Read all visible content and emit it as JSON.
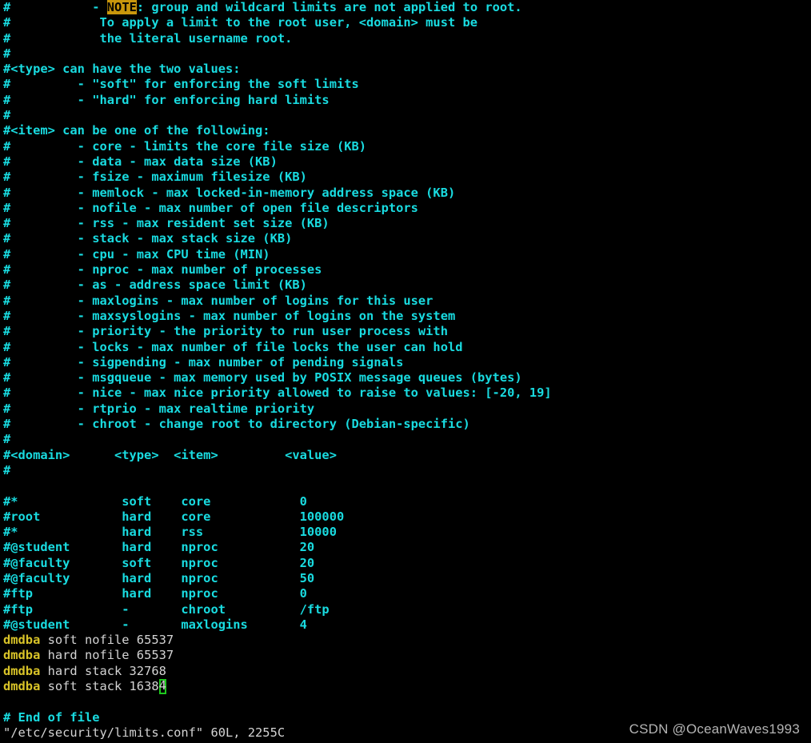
{
  "app": {
    "type": "terminal-text-editor",
    "editor": "vim",
    "background_color": "#000000",
    "comment_color": "#19dbe0",
    "value_color": "#d4d4d4",
    "keyword_color": "#d8c328",
    "note_highlight_bg": "#c8960c",
    "note_highlight_fg": "#000000",
    "cursor_color": "#1ec91e"
  },
  "file": {
    "path": "/etc/security/limits.conf",
    "status_line": "\"/etc/security/limits.conf\" 60L, 2255C",
    "line_count_label": "60L",
    "char_count_label": "2255C"
  },
  "cursor": {
    "char": "4",
    "line_index": 56,
    "column": 22
  },
  "note_block": {
    "bullet": "-",
    "label": "NOTE",
    "label_suffix": ": group and wildcard limits are not applied to root.",
    "prefix": "#",
    "indent": "           ",
    "continuation_lines": [
      "#            To apply a limit to the root user, <domain> must be",
      "#            the literal username root."
    ]
  },
  "sections": {
    "type_header": "#<type> can have the two values:",
    "type_values": [
      "#         - \"soft\" for enforcing the soft limits",
      "#         - \"hard\" for enforcing hard limits"
    ],
    "item_header": "#<item> can be one of the following:",
    "item_values": [
      "#         - core - limits the core file size (KB)",
      "#         - data - max data size (KB)",
      "#         - fsize - maximum filesize (KB)",
      "#         - memlock - max locked-in-memory address space (KB)",
      "#         - nofile - max number of open file descriptors",
      "#         - rss - max resident set size (KB)",
      "#         - stack - max stack size (KB)",
      "#         - cpu - max CPU time (MIN)",
      "#         - nproc - max number of processes",
      "#         - as - address space limit (KB)",
      "#         - maxlogins - max number of logins for this user",
      "#         - maxsyslogins - max number of logins on the system",
      "#         - priority - the priority to run user process with",
      "#         - locks - max number of file locks the user can hold",
      "#         - sigpending - max number of pending signals",
      "#         - msgqueue - max memory used by POSIX message queues (bytes)",
      "#         - nice - max nice priority allowed to raise to values: [-20, 19]",
      "#         - rtprio - max realtime priority",
      "#         - chroot - change root to directory (Debian-specific)"
    ]
  },
  "table": {
    "header_line": "#<domain>      <type>  <item>         <value>",
    "headers": [
      "#<domain>",
      "<type>",
      "<item>",
      "<value>"
    ],
    "commented_rows": [
      {
        "domain": "#*",
        "type": "soft",
        "item": "core",
        "value": "0",
        "line": "#*              soft    core            0"
      },
      {
        "domain": "#root",
        "type": "hard",
        "item": "core",
        "value": "100000",
        "line": "#root           hard    core            100000"
      },
      {
        "domain": "#*",
        "type": "hard",
        "item": "rss",
        "value": "10000",
        "line": "#*              hard    rss             10000"
      },
      {
        "domain": "#@student",
        "type": "hard",
        "item": "nproc",
        "value": "20",
        "line": "#@student       hard    nproc           20"
      },
      {
        "domain": "#@faculty",
        "type": "soft",
        "item": "nproc",
        "value": "20",
        "line": "#@faculty       soft    nproc           20"
      },
      {
        "domain": "#@faculty",
        "type": "hard",
        "item": "nproc",
        "value": "50",
        "line": "#@faculty       hard    nproc           50"
      },
      {
        "domain": "#ftp",
        "type": "hard",
        "item": "nproc",
        "value": "0",
        "line": "#ftp            hard    nproc           0"
      },
      {
        "domain": "#ftp",
        "type": "-",
        "item": "chroot",
        "value": "/ftp",
        "line": "#ftp            -       chroot          /ftp"
      },
      {
        "domain": "#@student",
        "type": "-",
        "item": "maxlogins",
        "value": "4",
        "line": "#@student       -       maxlogins       4"
      }
    ],
    "active_rows": [
      {
        "domain": "dmdba",
        "rest": " soft nofile 65537",
        "type": "soft",
        "item": "nofile",
        "value": "65537"
      },
      {
        "domain": "dmdba",
        "rest": " hard nofile 65537",
        "type": "hard",
        "item": "nofile",
        "value": "65537"
      },
      {
        "domain": "dmdba",
        "rest": " hard stack 32768",
        "type": "hard",
        "item": "stack",
        "value": "32768"
      },
      {
        "domain": "dmdba",
        "rest_before_cursor": " soft stack 1638",
        "cursor_char": "4",
        "type": "soft",
        "item": "stack",
        "value": "16384"
      }
    ]
  },
  "footer": {
    "end_of_file_comment": "# End of file"
  },
  "hash": "#",
  "watermark": "CSDN @OceanWaves1993"
}
